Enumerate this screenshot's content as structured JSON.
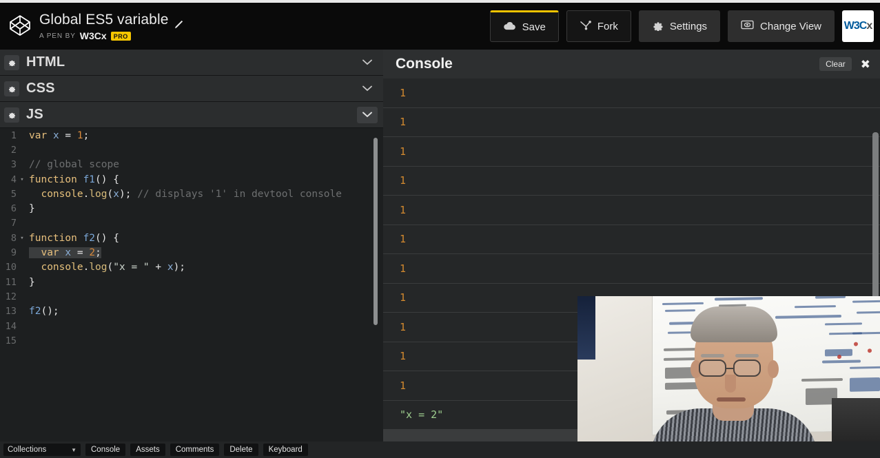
{
  "header": {
    "logo_icon": "codepen-logo-icon",
    "pen_title": "Global ES5 variable",
    "edit_icon": "pencil-icon",
    "byline_prefix": "A PEN BY",
    "author": "W3Cx",
    "pro_badge": "PRO",
    "buttons": [
      {
        "label": "Save",
        "icon": "cloud-icon",
        "style": "outline-accent"
      },
      {
        "label": "Fork",
        "icon": "fork-icon",
        "style": "outline"
      },
      {
        "label": "Settings",
        "icon": "gear-icon",
        "style": "solid"
      },
      {
        "label": "Change View",
        "icon": "eye-in-box-icon",
        "style": "solid"
      }
    ],
    "avatar": {
      "text_blue": "W3C",
      "text_grey": "x"
    },
    "accent_color": "#f4c400"
  },
  "panels": [
    {
      "title": "HTML",
      "gear_icon": "gear-icon",
      "chevron_icon": "chevron-down-icon",
      "collapsed": true
    },
    {
      "title": "CSS",
      "gear_icon": "gear-icon",
      "chevron_icon": "chevron-down-icon",
      "collapsed": true
    },
    {
      "title": "JS",
      "gear_icon": "gear-icon",
      "chevron_icon": "chevron-down-icon",
      "collapsed": false
    }
  ],
  "editor": {
    "language": "JS",
    "lines": [
      {
        "n": "1",
        "fold": "",
        "tokens": [
          {
            "t": "var",
            "c": "key"
          },
          {
            "t": " ",
            "c": "pun"
          },
          {
            "t": "x",
            "c": "var"
          },
          {
            "t": " = ",
            "c": "pun"
          },
          {
            "t": "1",
            "c": "num"
          },
          {
            "t": ";",
            "c": "pun"
          }
        ]
      },
      {
        "n": "2",
        "fold": "",
        "tokens": []
      },
      {
        "n": "3",
        "fold": "",
        "tokens": [
          {
            "t": "// global scope",
            "c": "com"
          }
        ]
      },
      {
        "n": "4",
        "fold": "▾",
        "tokens": [
          {
            "t": "function",
            "c": "key"
          },
          {
            "t": " ",
            "c": "pun"
          },
          {
            "t": "f1",
            "c": "fn"
          },
          {
            "t": "() {",
            "c": "pun"
          }
        ]
      },
      {
        "n": "5",
        "fold": "",
        "tokens": [
          {
            "t": "  ",
            "c": "pun"
          },
          {
            "t": "console",
            "c": "prop"
          },
          {
            "t": ".",
            "c": "pun"
          },
          {
            "t": "log",
            "c": "log"
          },
          {
            "t": "(",
            "c": "pun"
          },
          {
            "t": "x",
            "c": "var"
          },
          {
            "t": "); ",
            "c": "pun"
          },
          {
            "t": "// displays '1' in devtool console",
            "c": "com"
          }
        ]
      },
      {
        "n": "6",
        "fold": "",
        "tokens": [
          {
            "t": "}",
            "c": "pun"
          }
        ]
      },
      {
        "n": "7",
        "fold": "",
        "tokens": []
      },
      {
        "n": "8",
        "fold": "▾",
        "tokens": [
          {
            "t": "function",
            "c": "key"
          },
          {
            "t": " ",
            "c": "pun"
          },
          {
            "t": "f2",
            "c": "fn"
          },
          {
            "t": "() {",
            "c": "pun"
          }
        ]
      },
      {
        "n": "9",
        "fold": "",
        "selected": true,
        "tokens": [
          {
            "t": "  ",
            "c": "pun"
          },
          {
            "t": "var",
            "c": "key"
          },
          {
            "t": " ",
            "c": "pun"
          },
          {
            "t": "x",
            "c": "var"
          },
          {
            "t": " = ",
            "c": "pun"
          },
          {
            "t": "2",
            "c": "num"
          },
          {
            "t": ";",
            "c": "pun"
          }
        ]
      },
      {
        "n": "10",
        "fold": "",
        "tokens": [
          {
            "t": "  ",
            "c": "pun"
          },
          {
            "t": "console",
            "c": "prop"
          },
          {
            "t": ".",
            "c": "pun"
          },
          {
            "t": "log",
            "c": "log"
          },
          {
            "t": "(",
            "c": "pun"
          },
          {
            "t": "\"x = \"",
            "c": "str"
          },
          {
            "t": " + ",
            "c": "pun"
          },
          {
            "t": "x",
            "c": "var"
          },
          {
            "t": ");",
            "c": "pun"
          }
        ]
      },
      {
        "n": "11",
        "fold": "",
        "tokens": [
          {
            "t": "}",
            "c": "pun"
          }
        ]
      },
      {
        "n": "12",
        "fold": "",
        "tokens": []
      },
      {
        "n": "13",
        "fold": "",
        "tokens": [
          {
            "t": "f2",
            "c": "fn"
          },
          {
            "t": "();",
            "c": "pun"
          }
        ]
      },
      {
        "n": "14",
        "fold": "",
        "tokens": []
      },
      {
        "n": "15",
        "fold": "",
        "tokens": []
      }
    ]
  },
  "console": {
    "title": "Console",
    "clear_label": "Clear",
    "close_icon": "close-icon",
    "prompt_symbol": ">",
    "logs": [
      {
        "value": "1",
        "kind": "number"
      },
      {
        "value": "1",
        "kind": "number"
      },
      {
        "value": "1",
        "kind": "number"
      },
      {
        "value": "1",
        "kind": "number"
      },
      {
        "value": "1",
        "kind": "number"
      },
      {
        "value": "1",
        "kind": "number"
      },
      {
        "value": "1",
        "kind": "number"
      },
      {
        "value": "1",
        "kind": "number"
      },
      {
        "value": "1",
        "kind": "number"
      },
      {
        "value": "1",
        "kind": "number"
      },
      {
        "value": "1",
        "kind": "number"
      },
      {
        "value": "\"x = 2\"",
        "kind": "string"
      }
    ]
  },
  "webcam": {
    "label": "webcam-video-overlay"
  },
  "bottom_bar": {
    "collections_label": "Collections",
    "caret_icon": "caret-down-icon",
    "buttons": [
      "Console",
      "Assets",
      "Comments",
      "Delete",
      "Keyboard"
    ]
  }
}
